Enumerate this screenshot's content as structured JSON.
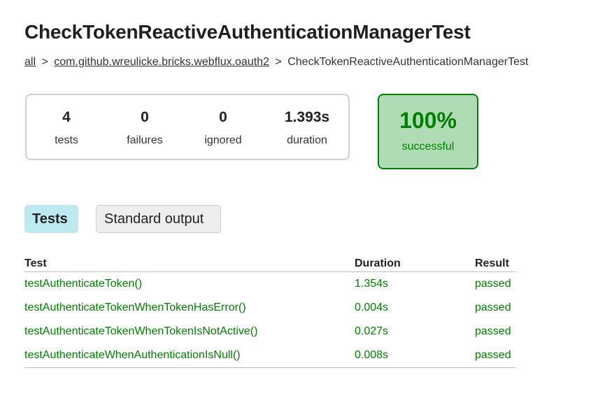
{
  "title": "CheckTokenReactiveAuthenticationManagerTest",
  "breadcrumb": {
    "all": "all",
    "sep1": ">",
    "package": "com.github.wreulicke.bricks.webflux.oauth2",
    "sep2": ">",
    "current": "CheckTokenReactiveAuthenticationManagerTest"
  },
  "summary": {
    "tests": {
      "value": "4",
      "label": "tests"
    },
    "failures": {
      "value": "0",
      "label": "failures"
    },
    "ignored": {
      "value": "0",
      "label": "ignored"
    },
    "duration": {
      "value": "1.393s",
      "label": "duration"
    }
  },
  "success": {
    "percent": "100%",
    "label": "successful"
  },
  "tabs": {
    "tests": "Tests",
    "stdout": "Standard output"
  },
  "table": {
    "headers": {
      "test": "Test",
      "duration": "Duration",
      "result": "Result"
    },
    "rows": [
      {
        "test": "testAuthenticateToken()",
        "duration": "1.354s",
        "result": "passed"
      },
      {
        "test": "testAuthenticateTokenWhenTokenHasError()",
        "duration": "0.004s",
        "result": "passed"
      },
      {
        "test": "testAuthenticateTokenWhenTokenIsNotActive()",
        "duration": "0.027s",
        "result": "passed"
      },
      {
        "test": "testAuthenticateWhenAuthenticationIsNull()",
        "duration": "0.008s",
        "result": "passed"
      }
    ]
  },
  "colors": {
    "success": "#008000",
    "success_bg": "#b0dcb5",
    "active_tab": "#bde9f1"
  }
}
